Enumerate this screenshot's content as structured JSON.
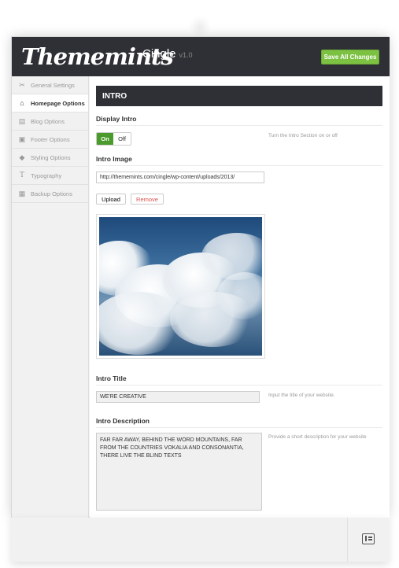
{
  "header": {
    "logo": "Thememints",
    "theme_name": "Cingle",
    "theme_version": "v1.0",
    "save_label": "Save All Changes",
    "save_color": "#7cc142"
  },
  "sidebar": {
    "items": [
      {
        "label": "General Settings",
        "icon": "wrench-icon",
        "active": false
      },
      {
        "label": "Homepage Options",
        "icon": "home-icon",
        "active": true
      },
      {
        "label": "Blog Options",
        "icon": "blog-icon",
        "active": false
      },
      {
        "label": "Footer Options",
        "icon": "footer-icon",
        "active": false
      },
      {
        "label": "Styling Options",
        "icon": "paint-bucket-icon",
        "active": false
      },
      {
        "label": "Typography",
        "icon": "typography-icon",
        "active": false
      },
      {
        "label": "Backup Options",
        "icon": "floppy-icon",
        "active": false
      }
    ]
  },
  "main": {
    "section_title": "INTRO",
    "display_intro": {
      "label": "Display Intro",
      "on_label": "On",
      "off_label": "Off",
      "value": "On",
      "hint": "Turn the Intro Section on or off"
    },
    "intro_image": {
      "label": "Intro Image",
      "value": "http://thememints.com/cingle/wp-content/uploads/2013/",
      "upload_label": "Upload",
      "remove_label": "Remove"
    },
    "intro_title": {
      "label": "Intro Title",
      "value": "WE'RE CREATIVE",
      "hint": "Input the title of your website."
    },
    "intro_description": {
      "label": "Intro Description",
      "value": "FAR FAR AWAY, BEHIND THE WORD MOUNTAINS, FAR FROM THE COUNTRIES VOKALIA AND CONSONANTIA, THERE LIVE THE BLIND TEXTS",
      "hint": "Provide a short description for your website"
    }
  },
  "footer": {
    "icon": "layout-icon"
  }
}
